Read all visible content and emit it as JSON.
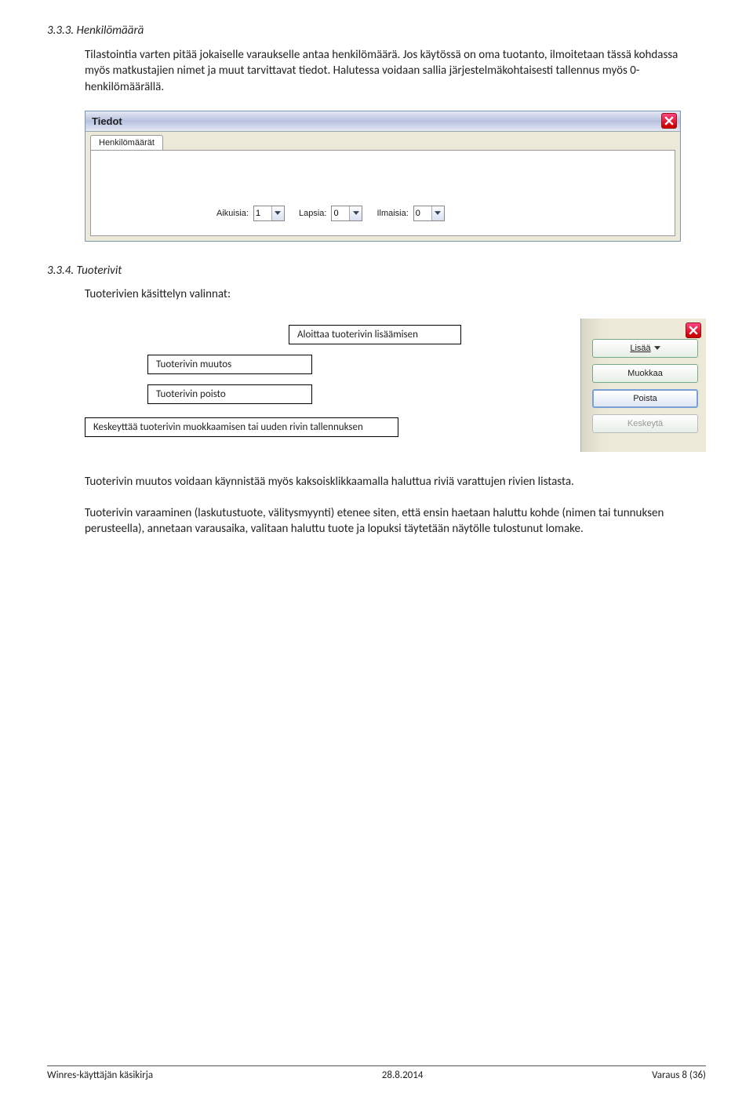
{
  "section333": {
    "title": "3.3.3. Henkilömäärä",
    "text": "Tilastointia varten pitää jokaiselle varaukselle antaa henkilömäärä. Jos käytössä on oma tuotanto, ilmoitetaan tässä kohdassa myös matkustajien nimet ja muut tarvittavat tiedot. Halutessa voidaan sallia järjestelmäkohtaisesti tallennus myös 0-henkilömäärällä."
  },
  "tiedotWindow": {
    "title": "Tiedot",
    "close_icon": "close",
    "tab": "Henkilömäärät",
    "fields": {
      "aikuisia": {
        "label": "Aikuisia:",
        "value": "1"
      },
      "lapsia": {
        "label": "Lapsia:",
        "value": "0"
      },
      "ilmaisia": {
        "label": "Ilmaisia:",
        "value": "0"
      }
    }
  },
  "section334": {
    "title": "3.3.4. Tuoterivit",
    "intro": "Tuoterivien käsittelyn valinnat:",
    "labels": {
      "add": "Aloittaa tuoterivin lisäämisen",
      "edit": "Tuoterivin muutos",
      "delete": "Tuoterivin poisto",
      "cancel": "Keskeyttää tuoterivin muokkaamisen tai uuden rivin tallennuksen"
    },
    "buttons": {
      "add": "Lisää",
      "edit": "Muokkaa",
      "delete": "Poista",
      "cancel": "Keskeytä"
    },
    "para1": "Tuoterivin muutos voidaan käynnistää myös kaksoisklikkaamalla haluttua riviä varattujen rivien listasta.",
    "para2": "Tuoterivin varaaminen (laskutustuote, välitysmyynti) etenee siten, että ensin haetaan haluttu kohde (nimen tai tunnuksen perusteella), annetaan varausaika, valitaan haluttu tuote ja lopuksi täytetään näytölle tulostunut lomake."
  },
  "footer": {
    "left": "Winres-käyttäjän käsikirja",
    "center": "28.8.2014",
    "right": "Varaus   8 (36)"
  }
}
